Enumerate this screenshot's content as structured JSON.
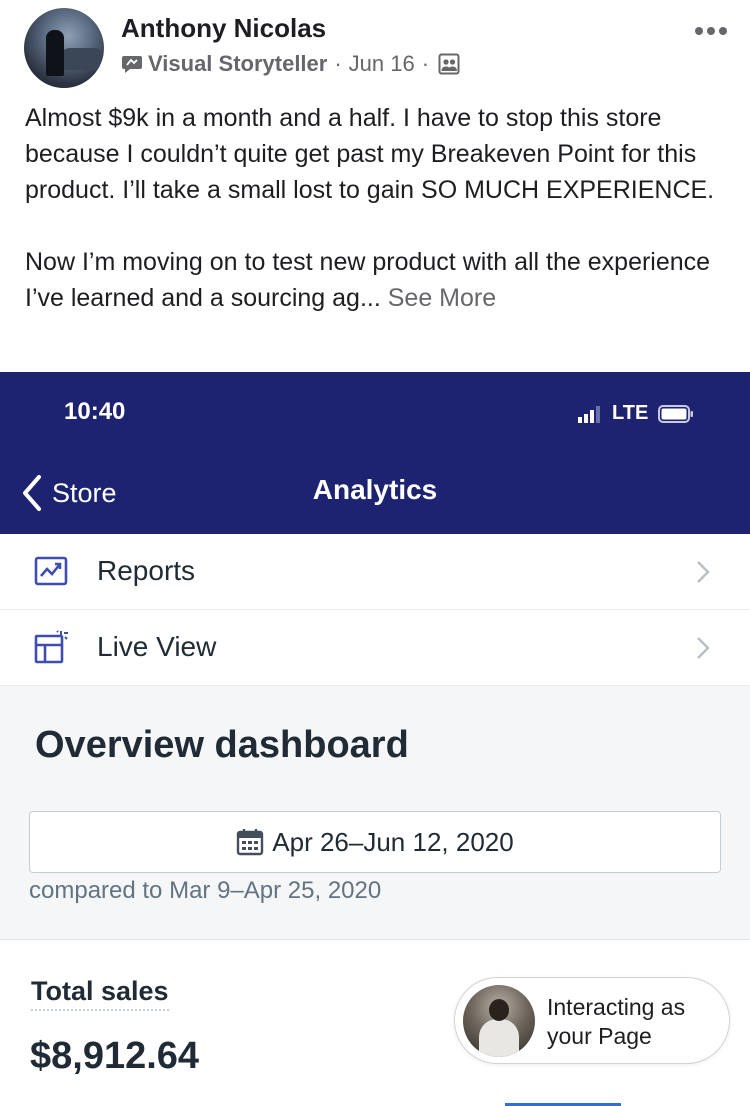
{
  "post": {
    "author": "Anthony Nicolas",
    "badge": "Visual Storyteller",
    "separator": "·",
    "date": "Jun 16",
    "paragraph1": "Almost $9k in a month and a half. I have to stop this store because I couldn’t quite get past my Breakeven Point for this product. I’ll take a small lost to gain SO MUCH EXPERIENCE.",
    "paragraph2": "Now I’m moving on to test new product with all the experience I’ve learned and a sourcing ag...",
    "see_more": "See More"
  },
  "phone": {
    "time": "10:40",
    "network": "LTE",
    "back_label": "Store",
    "title": "Analytics",
    "menu": [
      {
        "label": "Reports"
      },
      {
        "label": "Live View"
      }
    ],
    "overview_title": "Overview dashboard",
    "date_range": "Apr 26–Jun 12, 2020",
    "compared": "compared to Mar 9–Apr 25, 2020",
    "total_sales_label": "Total sales",
    "total_sales_value": "$8,912.64"
  },
  "pill": {
    "line1": "Interacting as",
    "line2": "your Page"
  },
  "colors": {
    "nav_background": "#1d2371",
    "muted_text": "#65676b",
    "accent_blue": "#2e6fdc"
  }
}
